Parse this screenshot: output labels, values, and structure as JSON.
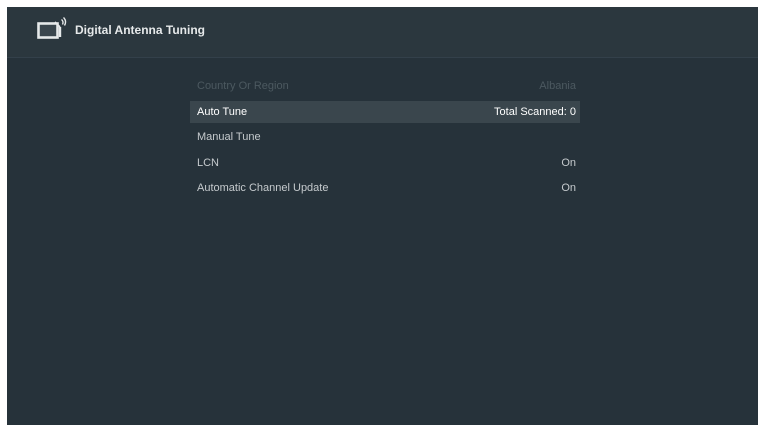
{
  "header": {
    "title": "Digital Antenna Tuning",
    "icon": "tv-antenna-icon"
  },
  "menu": {
    "items": [
      {
        "label": "Country Or Region",
        "value": "Albania",
        "state": "disabled"
      },
      {
        "label": "Auto Tune",
        "value": "Total Scanned: 0",
        "state": "focused"
      },
      {
        "label": "Manual Tune",
        "value": "",
        "state": "normal"
      },
      {
        "label": "LCN",
        "value": "On",
        "state": "normal"
      },
      {
        "label": "Automatic Channel Update",
        "value": "On",
        "state": "normal"
      }
    ]
  },
  "colors": {
    "background": "#26323a",
    "header_background": "#2b373e",
    "focused_row": "#3a464d",
    "text": "#c5cacd",
    "disabled_text": "#4c5960"
  }
}
